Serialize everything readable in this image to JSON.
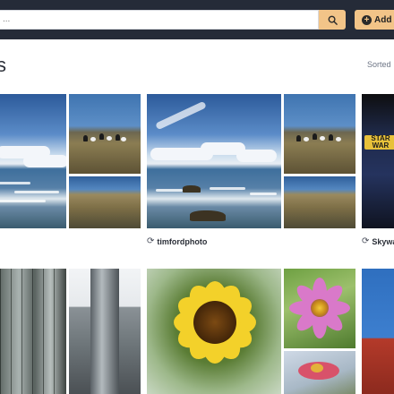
{
  "header": {
    "search_placeholder": "...",
    "search_icon": "search-icon",
    "add_label": "Add",
    "add_icon": "plus-circle-icon"
  },
  "page": {
    "heading": "s",
    "sort_label": "Sorted"
  },
  "albums": [
    {
      "caption": ""
    },
    {
      "caption": "timfordphoto"
    },
    {
      "caption": "Skywa"
    }
  ],
  "colors": {
    "topbar": "#252b38",
    "accent": "#f2c488"
  }
}
